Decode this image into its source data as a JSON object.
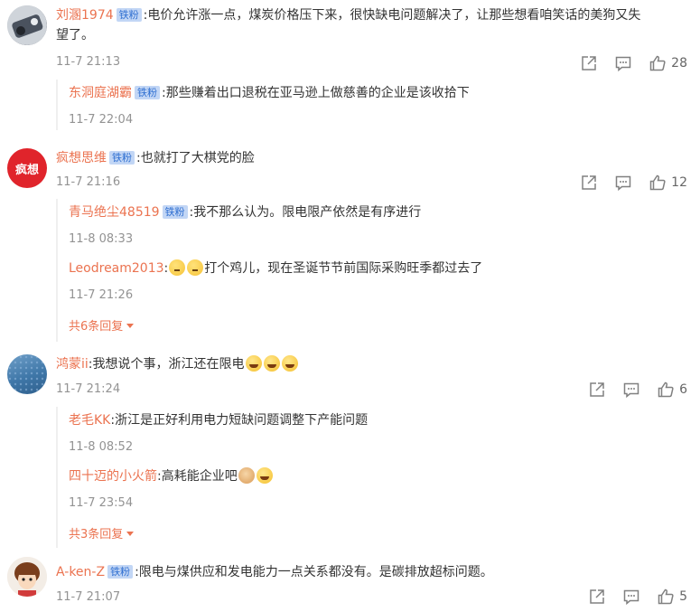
{
  "badge_label": "铁粉",
  "more_suffix": "",
  "comments": [
    {
      "user": "刘溷1974",
      "badge": true,
      "text": ":电价允许涨一点，煤炭价格压下来，很快缺电问题解决了，让那些想看咱笑话的美狗又失望了。",
      "text_line1": ":电价允许涨一点，煤炭价格压下来，很快缺电问题解决了，让那些想看咱笑话的美狗又失",
      "text_line2": "望了。",
      "time": "11-7 21:13",
      "likes": "28",
      "avatar": "avatar-1",
      "replies": [
        {
          "user": "东洞庭湖霸",
          "badge": true,
          "text": ":那些赚着出口退税在亚马逊上做慈善的企业是该收拾下",
          "time": "11-7 22:04"
        }
      ]
    },
    {
      "user": "疯想思维",
      "badge": true,
      "text": ":也就打了大棋党的脸",
      "time": "11-7 21:16",
      "likes": "12",
      "avatar_text": "疯想",
      "replies": [
        {
          "user": "青马绝尘48519",
          "badge": true,
          "text": ":我不那么认为。限电限产依然是有序进行",
          "time": "11-8 08:33"
        },
        {
          "user": "Leodream2013",
          "badge": false,
          "text": ":",
          "text_after": "打个鸡儿，现在圣诞节节前国际采购旺季都过去了",
          "time": "11-7 21:26"
        }
      ],
      "more": "共6条回复"
    },
    {
      "user": "鸿蒙ii",
      "badge": false,
      "text": ":我想说个事，浙江还在限电",
      "time": "11-7 21:24",
      "likes": "6",
      "replies": [
        {
          "user": "老毛KK",
          "badge": false,
          "text": ":浙江是正好利用电力短缺问题调整下产能问题",
          "time": "11-8 08:52"
        },
        {
          "user": "四十迈的小火箭",
          "badge": false,
          "text": ":高耗能企业吧",
          "time": "11-7 23:54"
        }
      ],
      "more": "共3条回复"
    },
    {
      "user": "A-ken-Z",
      "badge": true,
      "text": ":限电与煤供应和发电能力一点关系都没有。是碳排放超标问题。",
      "time": "11-7 21:07",
      "likes": "5"
    }
  ],
  "icons": {
    "share": "share-icon",
    "comment": "comment-icon",
    "like": "like-icon",
    "expand": "chevron-down-icon"
  },
  "colors": {
    "username": "#eb7350",
    "badge_bg": "#c2d6f5",
    "badge_text": "#2f6fd1",
    "time": "#939393"
  }
}
